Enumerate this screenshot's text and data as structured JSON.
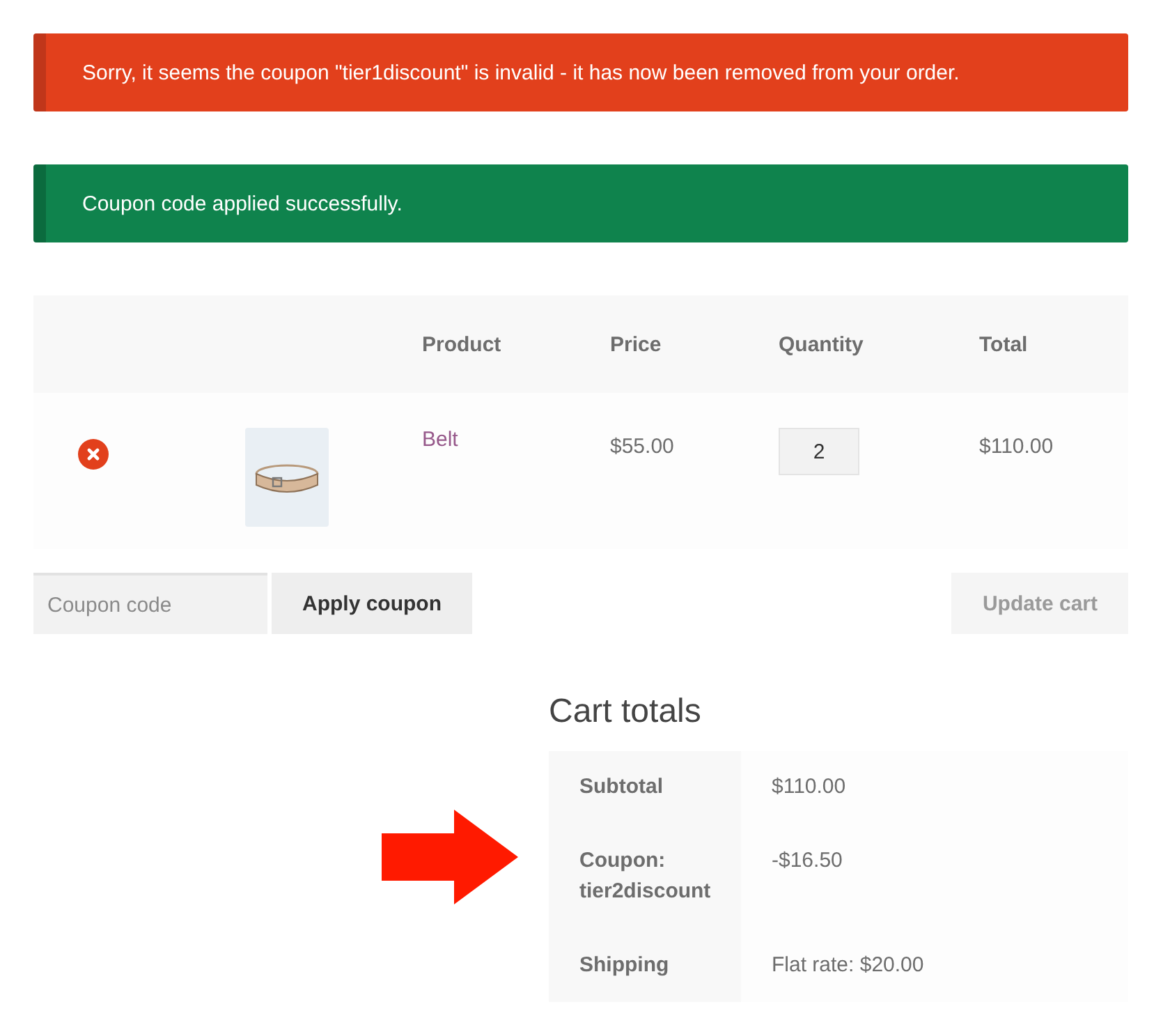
{
  "notices": [
    {
      "kind": "error",
      "text": "Sorry, it seems the coupon \"tier1discount\" is invalid - it has now been removed from your order."
    },
    {
      "kind": "success",
      "text": "Coupon code applied successfully."
    }
  ],
  "cart": {
    "columns": [
      "Product",
      "Price",
      "Quantity",
      "Total"
    ],
    "items": [
      {
        "product": "Belt",
        "price": "$55.00",
        "quantity": "2",
        "total": "$110.00"
      }
    ]
  },
  "coupon": {
    "placeholder": "Coupon code",
    "button": "Apply coupon"
  },
  "update_button": {
    "label": "Update cart",
    "disabled": true
  },
  "totals": {
    "title": "Cart totals",
    "rows": [
      {
        "label": "Subtotal",
        "value": "$110.00"
      },
      {
        "label": "Coupon: tier2discount",
        "value": "-$16.50"
      },
      {
        "label": "Shipping",
        "value": "Flat rate: $20.00"
      }
    ]
  }
}
